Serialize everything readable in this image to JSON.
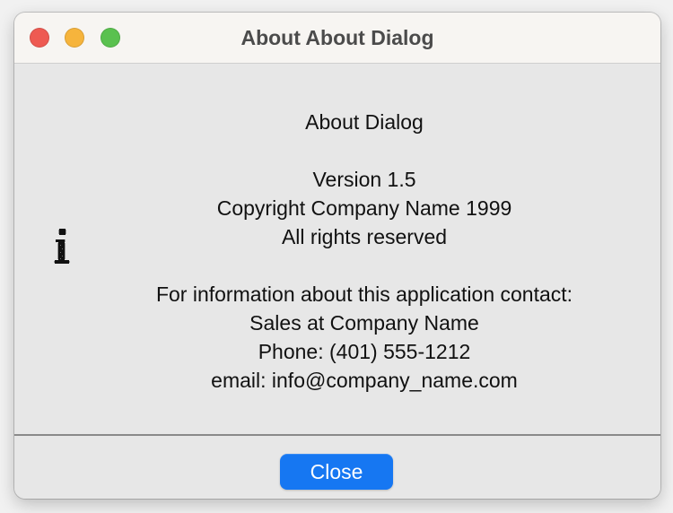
{
  "window": {
    "title": "About About Dialog"
  },
  "dialog": {
    "app_name": "About Dialog",
    "version": "Version 1.5",
    "copyright": "Copyright Company Name 1999",
    "rights": "All rights reserved",
    "contact_heading": "For information about this application contact:",
    "sales": "Sales at Company Name",
    "phone": "Phone: (401) 555-1212",
    "email": "email: info@company_name.com"
  },
  "footer": {
    "close_label": "Close"
  },
  "colors": {
    "accent": "#1677f2",
    "traffic_close": "#ee5a52",
    "traffic_minimize": "#f6b43c",
    "traffic_zoom": "#5ac14f"
  },
  "icons": {
    "dialog_icon": "info-icon"
  }
}
